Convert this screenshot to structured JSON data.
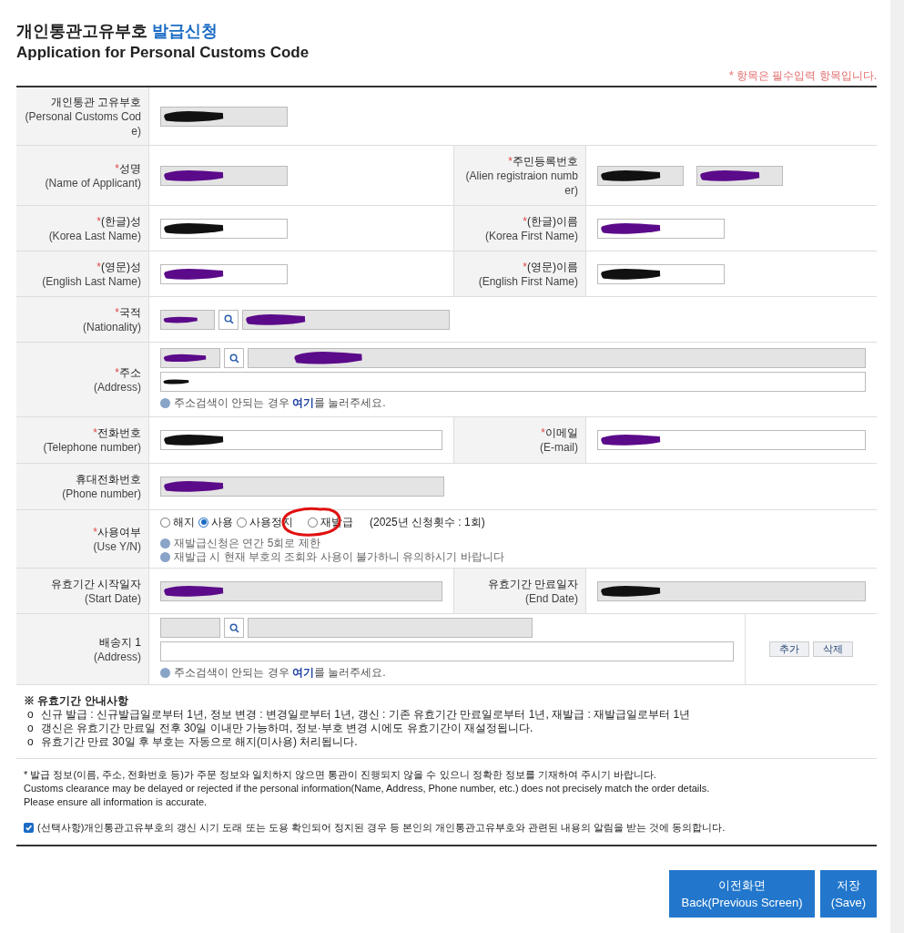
{
  "title": {
    "main": "개인통관고유부호",
    "highlight": "발급신청"
  },
  "subtitle": "Application for Personal Customs Code",
  "required_mark": "*",
  "required_note": "* 항목은 필수입력 항목입니다.",
  "rows": [
    {
      "cells": [
        {
          "label_ko": "개인통관 고유부호",
          "label_en": "(Personal Customs Code)",
          "required": false,
          "field": {
            "kind": "short_text",
            "readonly": true,
            "redacted": true
          }
        }
      ]
    },
    {
      "cells": [
        {
          "label_ko": "성명",
          "label_en": "(Name of Applicant)",
          "required": true,
          "field": {
            "kind": "short_text",
            "readonly": true,
            "redacted": true
          }
        },
        {
          "label_ko": "주민등록번호",
          "label_en": "(Alien registraion number)",
          "required": true,
          "field": {
            "kind": "split_text",
            "readonly": true,
            "redacted": true
          }
        }
      ]
    },
    {
      "cells": [
        {
          "label_ko": "(한글)성",
          "label_en": "(Korea Last Name)",
          "required": true,
          "field": {
            "kind": "short_text",
            "readonly": false,
            "redacted": true
          }
        },
        {
          "label_ko": "(한글)이름",
          "label_en": "(Korea First Name)",
          "required": true,
          "field": {
            "kind": "short_text",
            "readonly": false,
            "redacted": true
          }
        }
      ]
    },
    {
      "cells": [
        {
          "label_ko": "(영문)성",
          "label_en": "(English Last Name)",
          "required": true,
          "field": {
            "kind": "short_text",
            "readonly": false,
            "redacted": true
          }
        },
        {
          "label_ko": "(영문)이름",
          "label_en": "(English First Name)",
          "required": true,
          "field": {
            "kind": "short_text",
            "readonly": false,
            "redacted": true
          }
        }
      ]
    },
    {
      "cells": [
        {
          "label_ko": "국적",
          "label_en": "(Nationality)",
          "required": true,
          "field": {
            "kind": "lookup",
            "readonly": true,
            "redacted": true
          }
        }
      ]
    },
    {
      "cells": [
        {
          "label_ko": "주소",
          "label_en": "(Address)",
          "required": true,
          "field": {
            "kind": "address",
            "readonly": true,
            "redacted": true,
            "hint": {
              "before": "주소검색이 안되는 경우 ",
              "link": "여기",
              "after": "를 눌러주세요."
            }
          }
        }
      ]
    },
    {
      "cells": [
        {
          "label_ko": "전화번호",
          "label_en": "(Telephone number)",
          "required": true,
          "field": {
            "kind": "long_text",
            "readonly": false,
            "redacted": true
          }
        },
        {
          "label_ko": "이메일",
          "label_en": "(E-mail)",
          "required": true,
          "field": {
            "kind": "long_text",
            "readonly": false,
            "redacted": true
          }
        }
      ]
    },
    {
      "cells": [
        {
          "label_ko": "휴대전화번호",
          "label_en": "(Phone number)",
          "required": false,
          "field": {
            "kind": "long_text",
            "readonly": true,
            "redacted": true
          }
        }
      ]
    },
    {
      "cells": [
        {
          "label_ko": "사용여부",
          "label_en": "(Use Y/N)",
          "required": true,
          "field": {
            "kind": "radio_group",
            "options": [
              {
                "label": "해지",
                "selected": false
              },
              {
                "label": "사용",
                "selected": true
              },
              {
                "label": "사용정지",
                "selected": false
              },
              {
                "label": "재발급",
                "selected": false
              }
            ],
            "suffix": "(2025년 신청횟수 : 1회)",
            "notes": [
              "재발급신청은 연간 5회로 제한",
              "재발급 시 현재 부호의 조회와 사용이 불가하니 유의하시기 바랍니다"
            ]
          }
        }
      ]
    },
    {
      "cells": [
        {
          "label_ko": "유효기간 시작일자",
          "label_en": "(Start Date)",
          "required": false,
          "field": {
            "kind": "long_text",
            "readonly": true,
            "redacted": true
          }
        },
        {
          "label_ko": "유효기간 만료일자",
          "label_en": "(End Date)",
          "required": false,
          "field": {
            "kind": "long_text",
            "readonly": true,
            "redacted": true
          }
        }
      ]
    },
    {
      "cells": [
        {
          "label_ko": "배송지 1",
          "label_en": "(Address)",
          "required": false,
          "field": {
            "kind": "address",
            "readonly": true,
            "redacted": false,
            "hint": {
              "before": "주소검색이 안되는 경우 ",
              "link": "여기",
              "after": "를 눌러주세요."
            }
          }
        }
      ],
      "actions": [
        "추가",
        "삭제"
      ]
    }
  ],
  "validity_notes": {
    "heading": "※ 유효기간 안내사항",
    "items": [
      {
        "bullet": "o",
        "text": "신규 발급 : 신규발급일로부터 1년, 정보 변경 : 변경일로부터 1년, 갱신 : 기존 유효기간 만료일로부터 1년, 재발급 : 재발급일로부터 1년"
      },
      {
        "bullet": "o",
        "text": "갱신은 유효기간 만료일 전후 30일 이내만 가능하며, 정보·부호 변경 시에도 유효기간이 재설정됩니다."
      },
      {
        "bullet": "o",
        "text": "유효기간 만료 30일 후 부호는 자동으로 해지(미사용) 처리됩니다."
      }
    ]
  },
  "disclaimer": [
    "* 발급 정보(이름, 주소, 전화번호 등)가 주문 정보와 일치하지 않으면 통관이 진행되지 않을 수 있으니 정확한 정보를 기재하여 주시기 바랍니다.",
    "Customs clearance may be delayed or rejected if the personal information(Name, Address, Phone number, etc.) does not precisely match the order details.",
    "Please ensure all information is accurate."
  ],
  "consent": {
    "checked": true,
    "text": "(선택사항)개인통관고유부호의 갱신 시기 도래 또는 도용 확인되어 정지된 경우 등 본인의 개인통관고유부호와 관련된 내용의 알림을 받는 것에 동의합니다."
  },
  "buttons": [
    {
      "ko": "이전화면",
      "en": "Back(Previous Screen)"
    },
    {
      "ko": "저장",
      "en": "(Save)"
    }
  ]
}
